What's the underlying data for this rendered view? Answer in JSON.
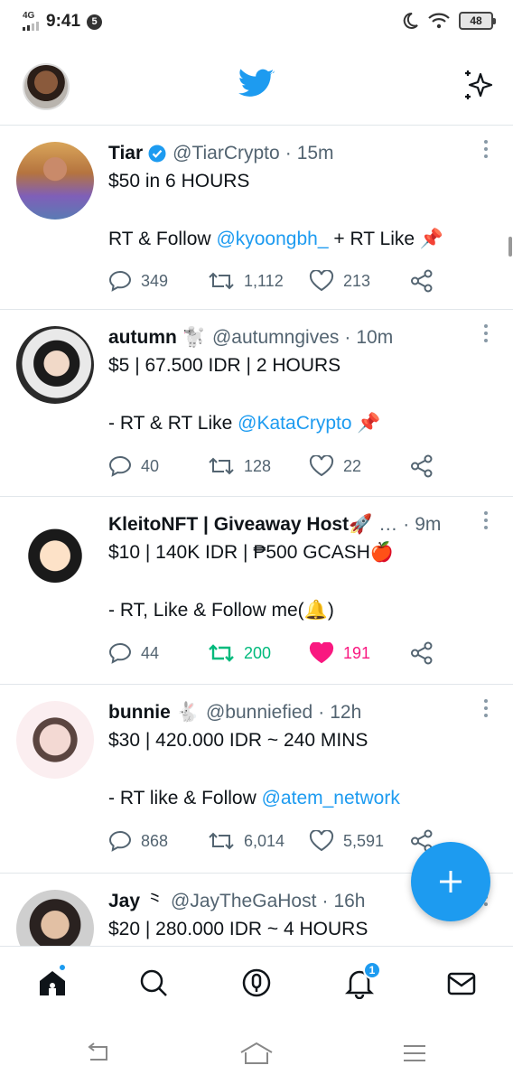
{
  "status_bar": {
    "network": "4G",
    "time": "9:41",
    "notification_count": "5",
    "battery": "48"
  },
  "header": {
    "logo_icon": "twitter-bird-icon",
    "sparkle_icon": "sparkle-icon",
    "accent": "#1d9bf0"
  },
  "tweets": [
    {
      "name": "Tiar",
      "emoji": "",
      "verified": true,
      "handle": "@TiarCrypto",
      "time": "15m",
      "line1": "$50 in 6 HOURS",
      "line2_pre": "RT & Follow ",
      "line2_link": "@kyoongbh_",
      "line2_post": " + RT Like 📌",
      "replies": "349",
      "retweets": "1,112",
      "likes": "213",
      "retweeted": false,
      "liked": false
    },
    {
      "name": "autumn",
      "emoji": "🐩",
      "verified": false,
      "handle": "@autumngives",
      "time": "10m",
      "line1": "$5 | 67.500 IDR | 2 HOURS",
      "line2_pre": "- RT & RT Like ",
      "line2_link": "@KataCrypto",
      "line2_post": " 📌",
      "replies": "40",
      "retweets": "128",
      "likes": "22",
      "retweeted": false,
      "liked": false
    },
    {
      "name": "KleitoNFT | Giveaway Host🚀",
      "emoji": "",
      "verified": false,
      "handle": "…",
      "time": "9m",
      "line1": "$10 | 140K IDR | ₱500 GCASH🍎",
      "line2_pre": "- RT, Like & Follow me(🔔)",
      "line2_link": "",
      "line2_post": "",
      "replies": "44",
      "retweets": "200",
      "likes": "191",
      "retweeted": true,
      "liked": true
    },
    {
      "name": "bunnie",
      "emoji": "🐇",
      "verified": false,
      "handle": "@bunniefied",
      "time": "12h",
      "line1": "$30 | 420.000 IDR ~ 240 MINS",
      "line2_pre": "- RT like & Follow ",
      "line2_link": "@atem_network",
      "line2_post": "",
      "replies": "868",
      "retweets": "6,014",
      "likes": "5,591",
      "retweeted": false,
      "liked": false
    },
    {
      "name": "Jay",
      "emoji": "⺀",
      "verified": false,
      "handle": "@JayTheGaHost",
      "time": "16h",
      "line1": "$20 | 280.000 IDR ~ 4 HOURS",
      "line2_pre": "",
      "line2_link": "",
      "line2_post": "",
      "replies": "",
      "retweets": "",
      "likes": "",
      "retweeted": false,
      "liked": false
    }
  ],
  "bottom_nav": {
    "items": [
      "home-icon",
      "search-icon",
      "spaces-icon",
      "notifications-icon",
      "messages-icon"
    ],
    "notification_badge": "1"
  },
  "system_nav": [
    "back-icon",
    "home-icon",
    "menu-icon"
  ],
  "colors": {
    "retweet_active": "#00ba7c",
    "like_active": "#f91880",
    "link": "#1d9bf0"
  }
}
